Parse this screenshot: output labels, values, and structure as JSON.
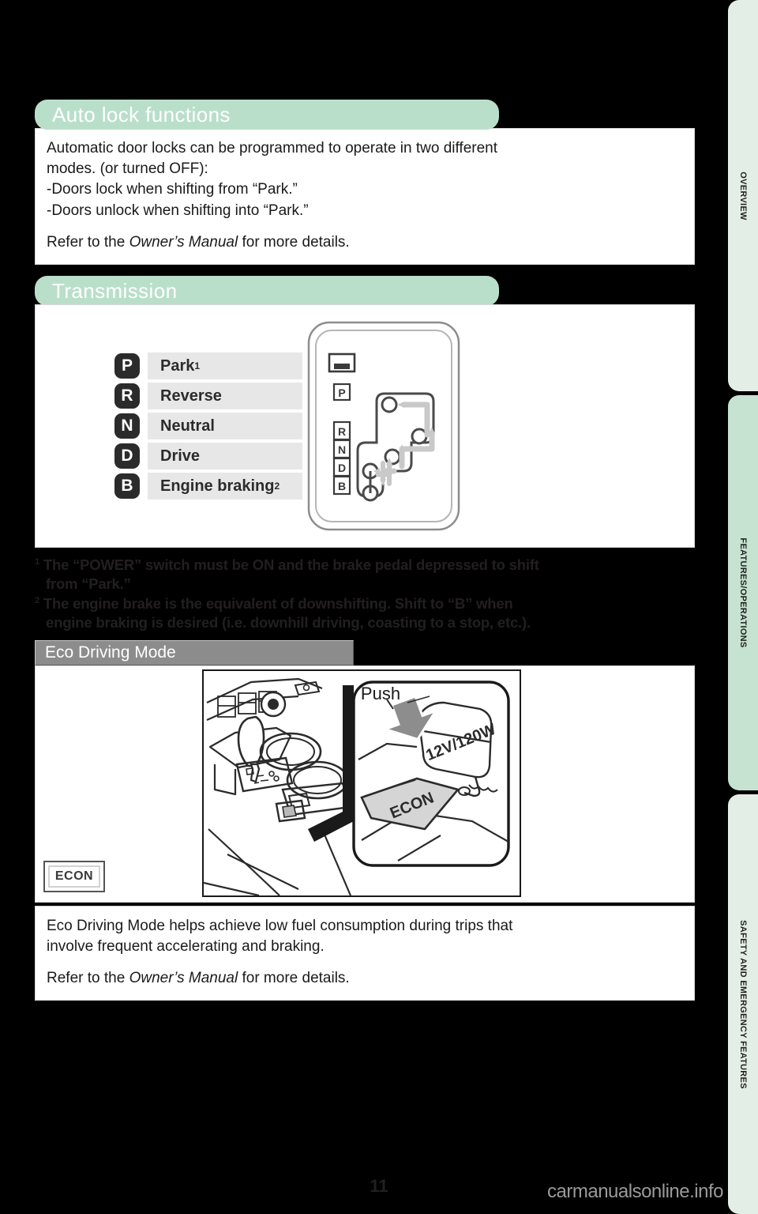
{
  "page": {
    "number": "11",
    "watermark": "carmanualsonline.info"
  },
  "sidebar": {
    "tabs": [
      {
        "label": "OVERVIEW",
        "color": "#e3efe6"
      },
      {
        "label": "FEATURES/OPERATIONS",
        "color": "#c5e3d0"
      },
      {
        "label": "SAFETY AND EMERGENCY FEATURES",
        "color": "#e3efe6"
      }
    ]
  },
  "sections": {
    "auto_lock": {
      "title": "Auto lock functions",
      "body_line_1": "Automatic door locks can be programmed to operate in two different",
      "body_line_2": "modes. (or turned OFF):",
      "bullet_1": "-Doors lock when shifting from “Park.”",
      "bullet_2": "-Doors unlock when shifting into “Park.”",
      "refer_prefix": "Refer to the ",
      "refer_italic": "Owner’s Manual",
      "refer_suffix": " for more details."
    },
    "transmission": {
      "title": "Transmission",
      "gears": [
        {
          "letter": "P",
          "name": "Park",
          "footnote": "1"
        },
        {
          "letter": "R",
          "name": "Reverse",
          "footnote": ""
        },
        {
          "letter": "N",
          "name": "Neutral",
          "footnote": ""
        },
        {
          "letter": "D",
          "name": "Drive",
          "footnote": ""
        },
        {
          "letter": "B",
          "name": "Engine braking",
          "footnote": "2"
        }
      ],
      "shifter_gate_labels": [
        "P",
        "R",
        "N",
        "D",
        "B"
      ],
      "footnotes": [
        {
          "marker": "1",
          "line_1": "The “POWER” switch must be ON and the brake pedal depressed to shift",
          "line_2": "from “Park.”"
        },
        {
          "marker": "2",
          "line_1": "The engine brake is the equivalent of downshifting. Shift to “B” when",
          "line_2": "engine braking is desired (i.e. downhill driving, coasting to a stop, etc.)."
        }
      ]
    },
    "eco": {
      "title": "Eco Driving Mode",
      "illustration": {
        "push_label": "Push",
        "outlet_label": "12V/120W",
        "button_label": "ECON"
      },
      "indicator_label": "ECON",
      "body_line_1": "Eco Driving Mode helps achieve low fuel consumption during trips that",
      "body_line_2": "involve frequent accelerating and braking.",
      "refer_prefix": "Refer to the ",
      "refer_italic": "Owner’s Manual",
      "refer_suffix": " for more details."
    }
  },
  "colors": {
    "header_green": "#b9dfca",
    "header_grey": "#8c8c8c",
    "tab_light": "#e3efe6",
    "tab_dark": "#c5e3d0",
    "gear_badge": "#2b2b2b",
    "gear_row": "#e7e7e7"
  }
}
